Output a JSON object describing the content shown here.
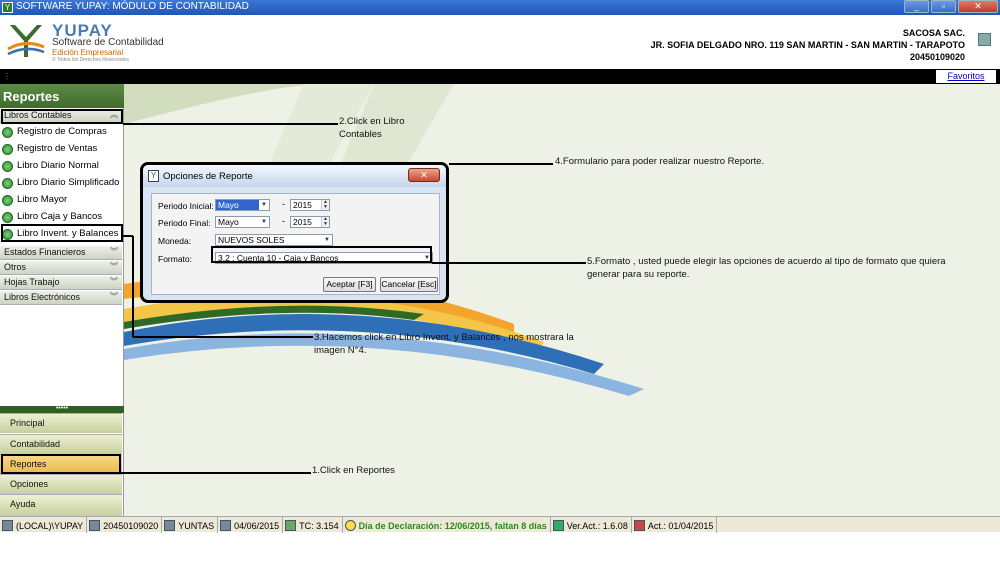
{
  "window": {
    "title": "SOFTWARE YUPAY: MÓDULO DE CONTABILIDAD",
    "min": "_",
    "max": "▫",
    "close": "✕"
  },
  "brand": {
    "name": "YUPAY",
    "tagline": "Software de Contabilidad",
    "edition": "Edición Empresarial",
    "rights": "© Todos los Derechos Reservados"
  },
  "company": {
    "name": "SACOSA SAC.",
    "address": "JR. SOFIA DELGADO NRO. 119 SAN MARTIN - SAN MARTIN - TARAPOTO",
    "ruc": "20450109020"
  },
  "favorites": "Favoritos",
  "sidebar": {
    "title": "Reportes",
    "open_section": "Libros Contables",
    "items": [
      "Registro de Compras",
      "Registro de Ventas",
      "Libro Diario Normal",
      "Libro Diario Simplificado",
      "Libro Mayor",
      "Libro Caja y Bancos",
      "Libro Invent. y Balances"
    ],
    "sections": [
      "Estados Financieros",
      "Otros",
      "Hojas Trabajo",
      "Libros Electrónicos"
    ],
    "grip": "•••••",
    "bottom_tabs": [
      "Principal",
      "Contabilidad",
      "Reportes",
      "Opciones",
      "Ayuda"
    ]
  },
  "dialog": {
    "title": "Opciones de Reporte",
    "close": "✕",
    "labels": {
      "periodo_inicial": "Periodo Inicial:",
      "periodo_final": "Periodo Final:",
      "moneda": "Moneda:",
      "formato": "Formato:"
    },
    "periodo_inicial": {
      "month": "Mayo",
      "year": "2015"
    },
    "periodo_final": {
      "month": "Mayo",
      "year": "2015"
    },
    "separator": "-",
    "moneda": "NUEVOS SOLES",
    "formato": "3.2  : Cuenta 10 - Caja y Bancos",
    "accept": "Aceptar [F3]",
    "cancel": "Cancelar [Esc]"
  },
  "callouts": {
    "c1": "1.Click en Reportes",
    "c2": "2.Click en Libro Contables",
    "c3": "3.Hacemos click en Libro Invent. y Balances , nos mostrara la imagen N°4.",
    "c4": "4.Formulario para poder realizar nuestro Reporte.",
    "c5": "5.Formato , usted puede elegir las opciones de acuerdo al tipo de formato que quiera generar para su reporte."
  },
  "status": {
    "server": "(LOCAL)\\YUPAY",
    "ruc": "20450109020",
    "user": "YUNTAS",
    "date": "04/06/2015",
    "tc": "TC: 3.154",
    "declaracion": "Día de Declaración: 12/06/2015, faltan 8 días",
    "version": "Ver.Act.: 1.6.08",
    "act": "Act.: 01/04/2015"
  },
  "colors": {
    "sidebar_green": "#3f6a2c",
    "status_green": "#2a8a1a",
    "brand_blue": "#4a7ab2"
  }
}
